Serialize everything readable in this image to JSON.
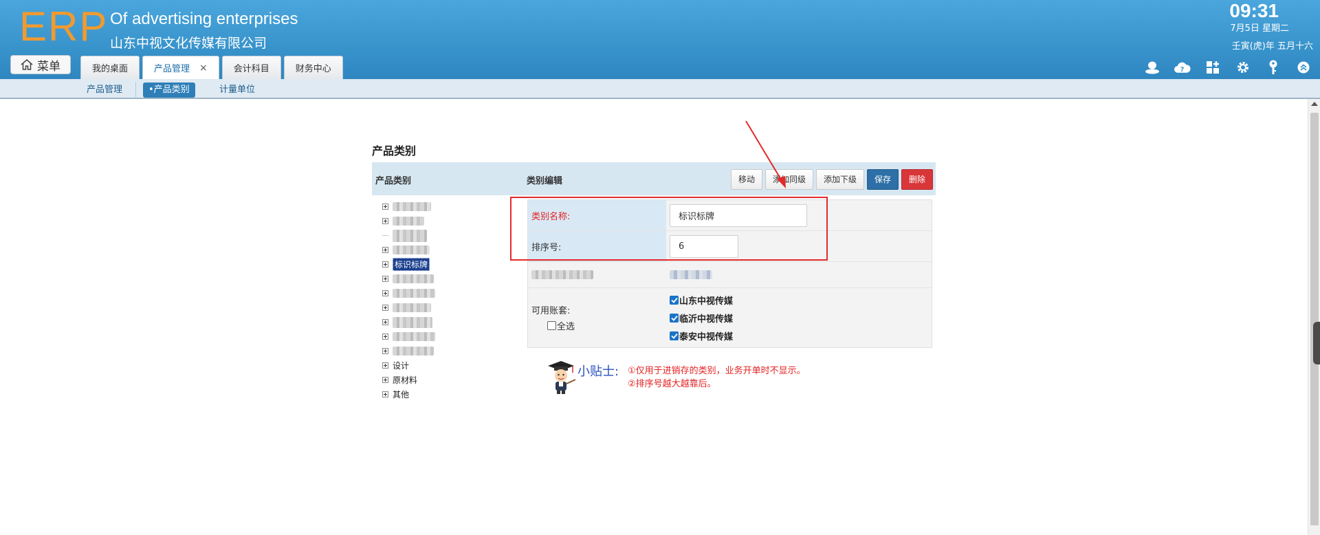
{
  "header": {
    "logo": "ERP",
    "company_en": "Of advertising enterprises",
    "company_cn": "山东中视文化传媒有限公司",
    "clock": "09:31",
    "date": "7月5日 星期二",
    "lunar": "壬寅(虎)年 五月十六",
    "menu_label": "菜单",
    "tabs": [
      {
        "label": "我的桌面",
        "active": false
      },
      {
        "label": "产品管理",
        "active": true,
        "close": "×"
      },
      {
        "label": "会计科目",
        "active": false
      },
      {
        "label": "财务中心",
        "active": false
      }
    ],
    "icons": [
      "user-icon",
      "cloud-help-icon",
      "apps-grid-icon",
      "settings-gear-icon",
      "key-icon",
      "collapse-up-icon"
    ]
  },
  "subnav": {
    "items": [
      {
        "label": "产品管理",
        "active": false
      },
      {
        "label": "•产品类别",
        "active": true
      },
      {
        "label": "计量单位",
        "active": false
      }
    ]
  },
  "main": {
    "title": "产品类别",
    "left_header": "产品类别",
    "right_header": "类别编辑",
    "buttons": {
      "move": "移动",
      "add_sibling": "添加同级",
      "add_child": "添加下级",
      "save": "保存",
      "delete": "删除"
    },
    "tree": {
      "selected": "标识标牌",
      "labeled": [
        "设计",
        "原材料",
        "其他"
      ]
    },
    "form": {
      "name_label": "类别名称:",
      "name_value": "标识标牌",
      "order_label": "排序号:",
      "order_value": "6",
      "accounts_label": "可用账套:",
      "select_all": "全选",
      "accounts": [
        "山东中视传媒",
        "临沂中视传媒",
        "泰安中视传媒"
      ]
    },
    "tips": {
      "title": "小贴士:",
      "line1": "①仅用于进销存的类别，业务开单时不显示。",
      "line2": "②排序号越大越靠后。"
    }
  }
}
